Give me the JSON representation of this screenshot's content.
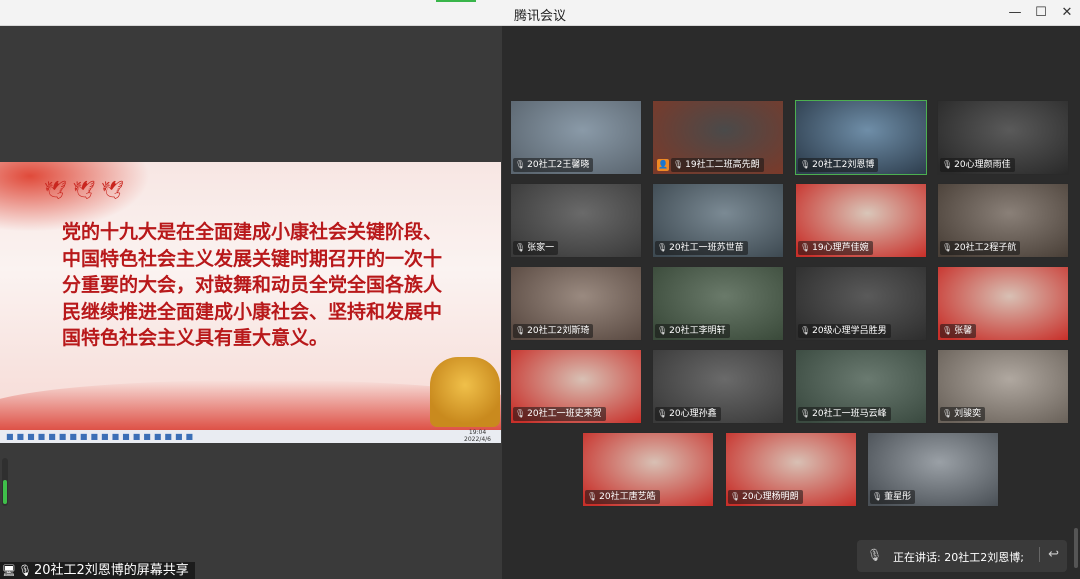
{
  "window": {
    "title": "腾讯会议",
    "minimize_icon": "—",
    "maximize_icon": "☐",
    "close_icon": "✕"
  },
  "share": {
    "label": "20社工2刘恩博的屏幕共享",
    "slide_text": "党的十九大是在全面建成小康社会关键阶段、中国特色社会主义发展关键时期召开的一次十分重要的大会，对鼓舞和动员全党全国各族人民继续推进全面建成小康社会、坚持和发展中国特色社会主义具有重大意义。",
    "taskbar_time": "19:04",
    "taskbar_date": "2022/4/6",
    "volume_level": 0.55
  },
  "participants": [
    {
      "name": "20社工2王馨晓",
      "active": false
    },
    {
      "name": "19社工二班高先朗",
      "active": false,
      "host": true
    },
    {
      "name": "20社工2刘恩博",
      "active": true
    },
    {
      "name": "20心理颜雨佳",
      "active": false
    },
    {
      "name": "张家一",
      "active": false
    },
    {
      "name": "20社工一班苏世苗",
      "active": false
    },
    {
      "name": "19心理芦佳婉",
      "active": false
    },
    {
      "name": "20社工2程子航",
      "active": false
    },
    {
      "name": "20社工2刘斯琦",
      "active": false
    },
    {
      "name": "20社工李明轩",
      "active": false
    },
    {
      "name": "20级心理学吕胜男",
      "active": false
    },
    {
      "name": "张馨",
      "active": false
    },
    {
      "name": "20社工一班史来贺",
      "active": false
    },
    {
      "name": "20心理孙鑫",
      "active": false
    },
    {
      "name": "20社工一班马云峰",
      "active": false
    },
    {
      "name": "刘骏奕",
      "active": false
    },
    {
      "name": "20社工唐艺皓",
      "active": false
    },
    {
      "name": "20心理杨明朗",
      "active": false
    },
    {
      "name": "董星彤",
      "active": false
    }
  ],
  "speaking": {
    "label": "正在讲话: 20社工2刘恩博;"
  },
  "colors": {
    "accent_green": "#4caf50",
    "slide_red": "#b8181a"
  }
}
